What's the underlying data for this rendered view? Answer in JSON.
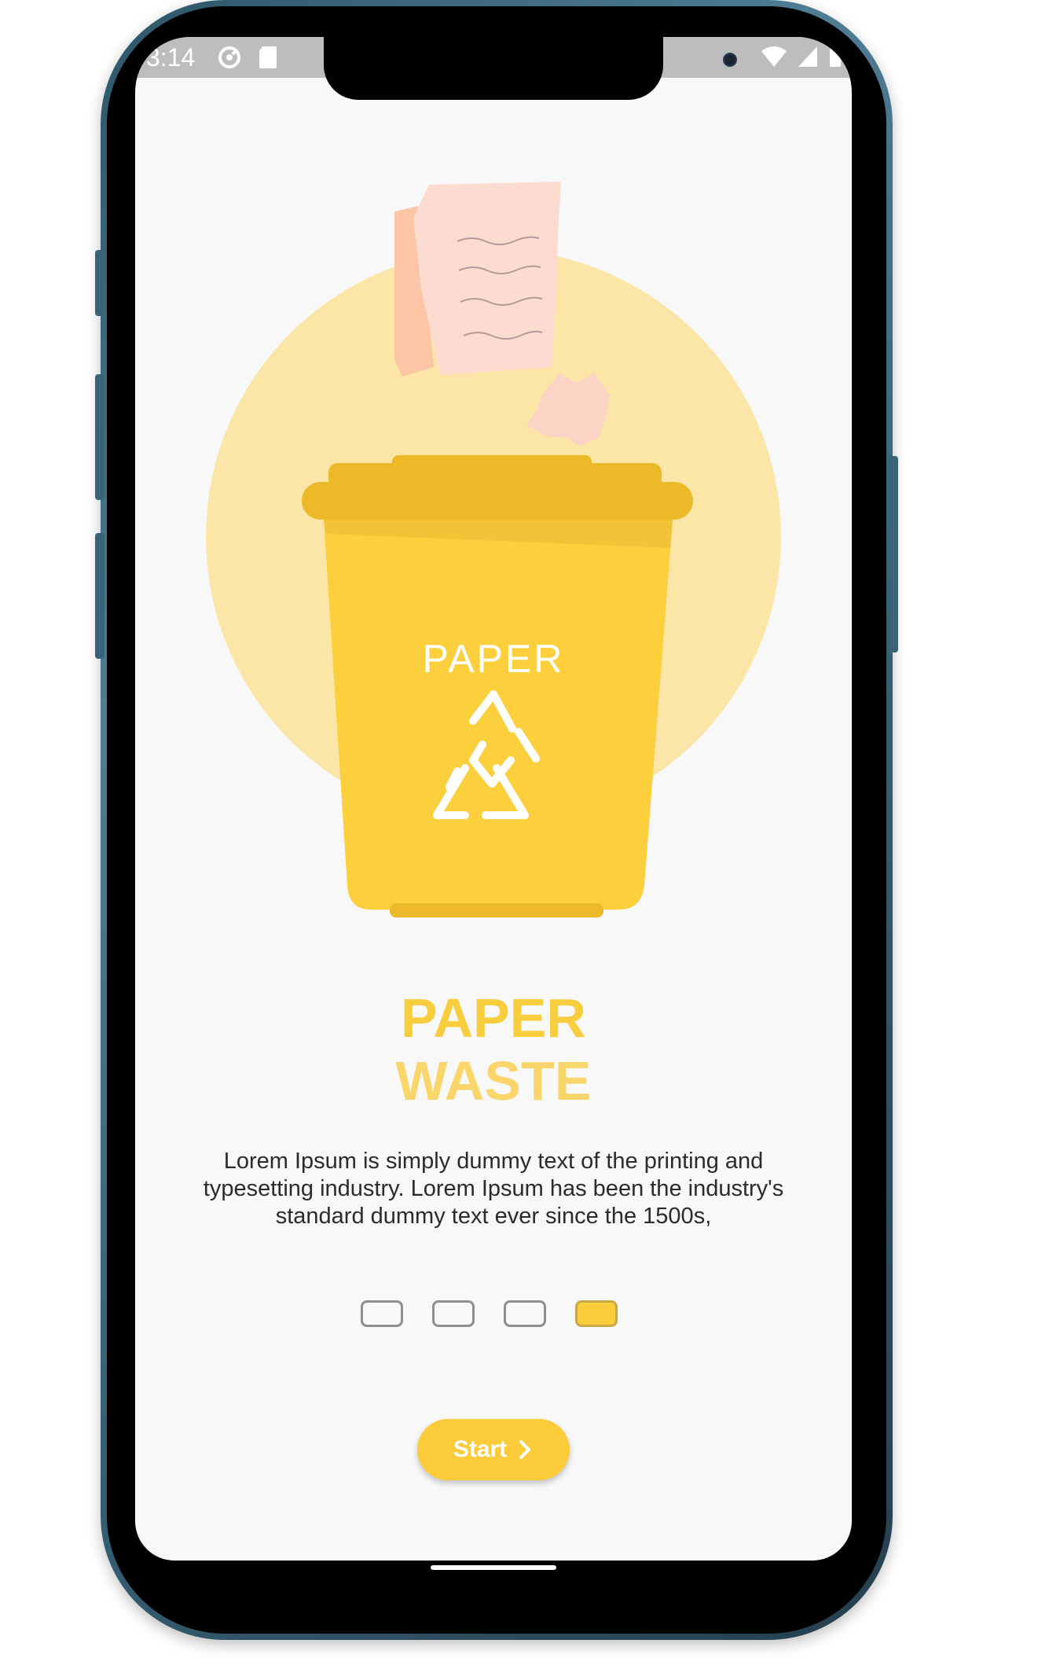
{
  "status_bar": {
    "time": "3:14",
    "left_icons": [
      "at-sign-icon",
      "sd-card-icon"
    ],
    "right_icons": [
      "wifi-icon",
      "signal-icon",
      "battery-icon"
    ]
  },
  "illustration": {
    "bin_label": "PAPER",
    "icons": [
      "paper-sheet-icon",
      "crumpled-paper-icon",
      "recycle-icon"
    ]
  },
  "onboarding": {
    "title_line1": "PAPER",
    "title_line2": "WASTE",
    "description": "Lorem Ipsum is simply dummy text of the printing and typesetting industry. Lorem Ipsum has been the industry's standard dummy text ever since the 1500s,",
    "page_count": 4,
    "active_page": 4,
    "start_label": "Start"
  },
  "colors": {
    "accent": "#FBCB3A",
    "circle": "#FBE6A8",
    "bin": "#FCCF3D",
    "bin_rim": "#ECB929",
    "paper": "#FCDCD0",
    "background": "#F8F8F8"
  }
}
